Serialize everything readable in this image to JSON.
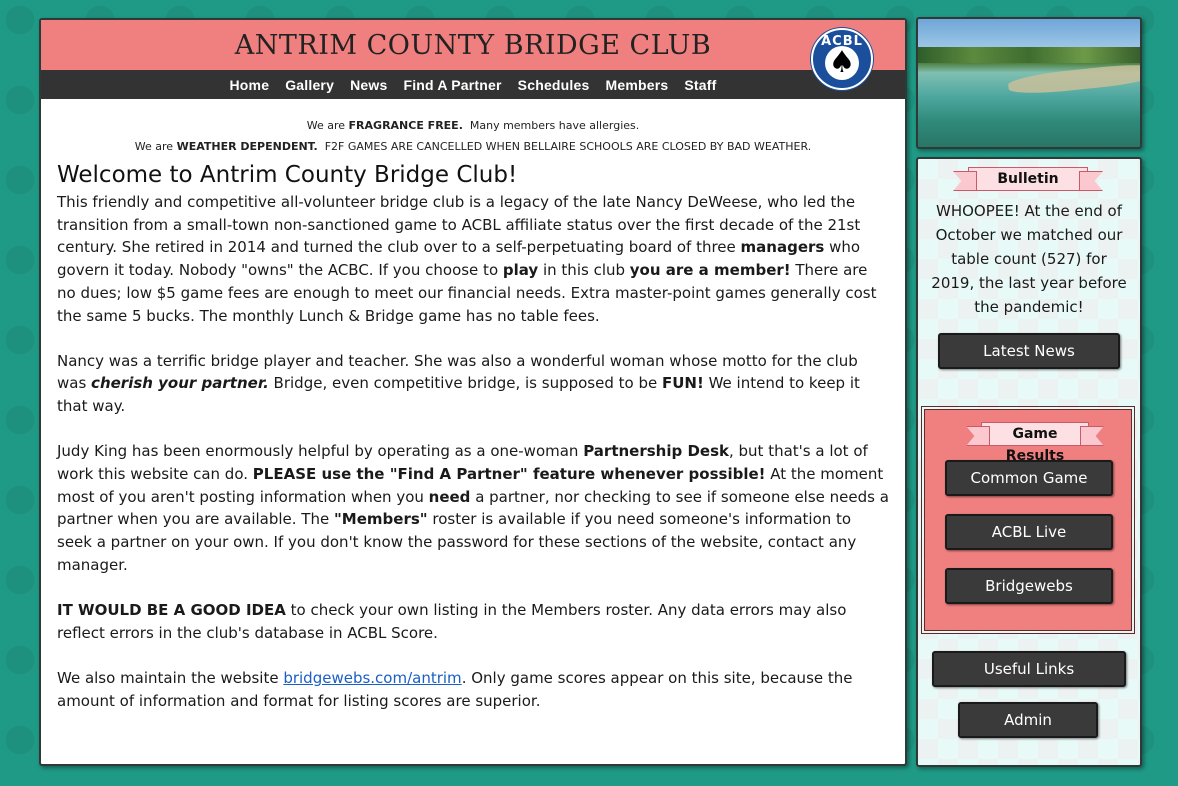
{
  "header": {
    "site_title": "ANTRIM COUNTY BRIDGE CLUB",
    "logo_text": "ACBL",
    "logo_symbol": "♠"
  },
  "nav": {
    "items": [
      {
        "label": "Home"
      },
      {
        "label": "Gallery"
      },
      {
        "label": "News"
      },
      {
        "label": "Find A Partner"
      },
      {
        "label": "Schedules"
      },
      {
        "label": "Members"
      },
      {
        "label": "Staff"
      }
    ]
  },
  "notices": {
    "fragrance_prefix": "We are ",
    "fragrance_bold": "FRAGRANCE FREE.",
    "fragrance_rest": "  Many members have allergies.",
    "weather_prefix": "We are ",
    "weather_bold": "WEATHER DEPENDENT.",
    "weather_rest": "  F2F GAMES ARE CANCELLED WHEN BELLAIRE SCHOOLS ARE CLOSED BY BAD WEATHER."
  },
  "main": {
    "heading": "Welcome to Antrim County Bridge Club!",
    "p1": {
      "a": "This friendly and competitive all-volunteer bridge club is a legacy of the late Nancy DeWeese, who led the transition from a small-town non-sanctioned game to ACBL affiliate status over the first decade of the 21st century.  She retired in 2014 and turned the club over to a self-perpetuating board of three ",
      "b": "managers",
      "c": " who govern it today.  Nobody \"owns\" the ACBC.  If you choose to ",
      "d": "play",
      "e": " in this club ",
      "f": "you are a member!",
      "g": "  There are no dues; low $5 game fees are enough to meet our financial needs.  Extra master-point games generally cost the same 5 bucks.  The monthly Lunch & Bridge game has no table fees."
    },
    "p2": {
      "a": "Nancy was a terrific bridge player and teacher.  She was also a wonderful woman whose motto for the club was ",
      "b": "cherish your partner.",
      "c": "  Bridge, even competitive bridge, is supposed to be ",
      "d": "FUN!",
      "e": "  We intend to keep it that way."
    },
    "p3": {
      "a": "Judy King has been enormously helpful by operating as a one-woman ",
      "b": "Partnership Desk",
      "c": ", but that's a lot of work this website can do.  ",
      "d": "PLEASE use the \"Find A Partner\" feature whenever possible!",
      "e": "  At the moment most of you aren't posting information when you ",
      "f": "need",
      "g": " a partner, nor checking to see if someone else needs a partner when you are available.  The ",
      "h": "\"Members\"",
      "i": " roster is available if you need someone's information to seek a partner on your own.  If you don't know the password for these sections of the website, contact any manager."
    },
    "p4": {
      "a": "IT WOULD BE A GOOD IDEA",
      "b": " to check your own listing in the Members roster.  Any data errors may also reflect errors in the club's database in ACBL Score."
    },
    "p5": {
      "a": "We also maintain the website ",
      "link": "bridgewebs.com/antrim",
      "b": ".  Only game scores appear on this site, because the amount of information and format for listing scores are superior."
    }
  },
  "sidebar": {
    "bulletin_title": "Bulletin",
    "bulletin_text": "WHOOPEE! At the end of October we matched our table count (527) for 2019, the last year before the pandemic!",
    "latest_news": "Latest News",
    "game_results_title": "Game Results",
    "common_game": "Common Game",
    "acbl_live": "ACBL Live",
    "bridgewebs": "Bridgewebs",
    "useful_links": "Useful Links",
    "admin": "Admin"
  },
  "colors": {
    "page_bg": "#1f9a86",
    "header_bg": "#f08080",
    "nav_bg": "#333333",
    "button_bg": "#3a3a3a",
    "link": "#1a5fc4"
  }
}
